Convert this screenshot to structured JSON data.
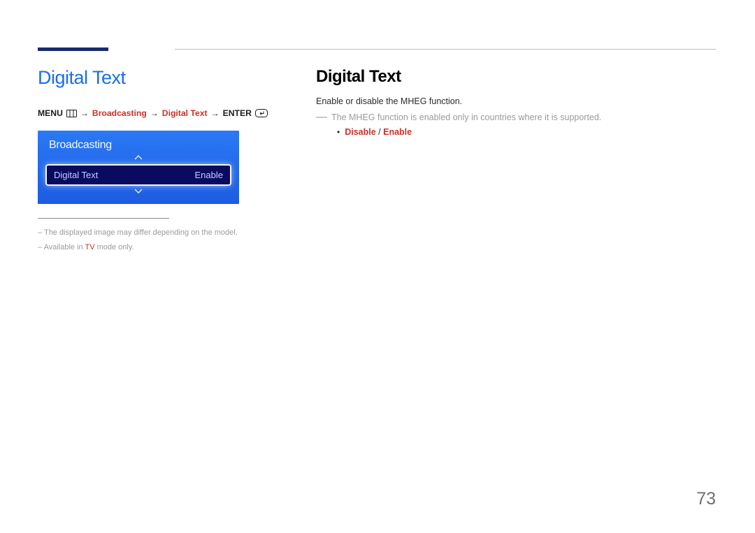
{
  "page_number": "73",
  "left": {
    "title": "Digital Text",
    "breadcrumb": {
      "menu": "MENU",
      "broadcasting": "Broadcasting",
      "digital_text": "Digital Text",
      "enter": "ENTER"
    },
    "osd": {
      "header": "Broadcasting",
      "row_label": "Digital Text",
      "row_value": "Enable"
    },
    "footnotes": {
      "n1_prefix": "–  The displayed image may differ depending on the model.",
      "n2_prefix": "–  Available in ",
      "n2_red": "TV",
      "n2_suffix": " mode only."
    }
  },
  "right": {
    "title": "Digital Text",
    "desc": "Enable or disable the MHEG function.",
    "note": "The MHEG function is enabled only in countries where it is supported.",
    "option_disable": "Disable",
    "option_enable": "Enable"
  }
}
